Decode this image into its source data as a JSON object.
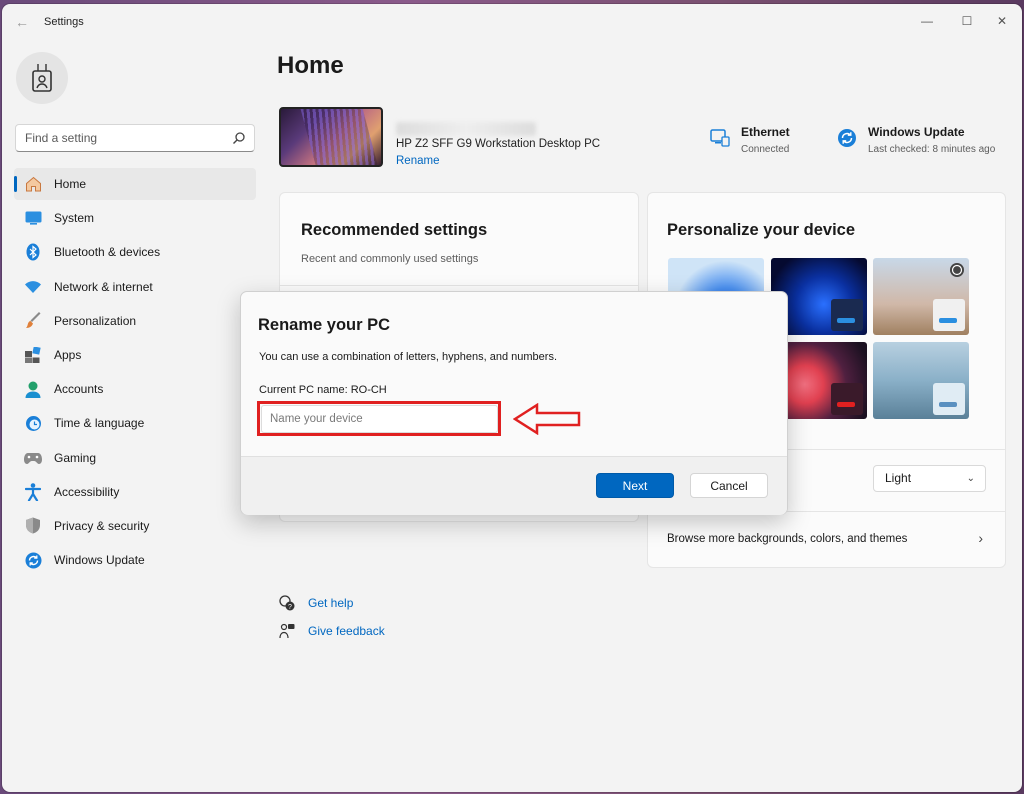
{
  "window": {
    "title": "Settings"
  },
  "sidebar": {
    "search": {
      "placeholder": "Find a setting"
    },
    "items": [
      {
        "label": "Home",
        "icon": "home-icon",
        "selected": true
      },
      {
        "label": "System",
        "icon": "system-icon"
      },
      {
        "label": "Bluetooth & devices",
        "icon": "bluetooth-icon"
      },
      {
        "label": "Network & internet",
        "icon": "wifi-icon"
      },
      {
        "label": "Personalization",
        "icon": "brush-icon"
      },
      {
        "label": "Apps",
        "icon": "apps-icon"
      },
      {
        "label": "Accounts",
        "icon": "account-icon"
      },
      {
        "label": "Time & language",
        "icon": "clock-globe-icon"
      },
      {
        "label": "Gaming",
        "icon": "gamepad-icon"
      },
      {
        "label": "Accessibility",
        "icon": "accessibility-icon"
      },
      {
        "label": "Privacy & security",
        "icon": "shield-icon"
      },
      {
        "label": "Windows Update",
        "icon": "update-icon"
      }
    ]
  },
  "main": {
    "title": "Home",
    "device": {
      "model": "HP Z2 SFF G9 Workstation Desktop PC",
      "rename_label": "Rename"
    },
    "status": {
      "ethernet": {
        "title": "Ethernet",
        "sub": "Connected"
      },
      "update": {
        "title": "Windows Update",
        "sub": "Last checked: 8 minutes ago"
      }
    },
    "recommended": {
      "title": "Recommended settings",
      "subtitle": "Recent and commonly used settings"
    },
    "personalize": {
      "title": "Personalize your device",
      "mode_value": "Light",
      "browse_label": "Browse more backgrounds, colors, and themes"
    },
    "help": {
      "get_help": "Get help",
      "give_feedback": "Give feedback"
    }
  },
  "dialog": {
    "title": "Rename your PC",
    "description": "You can use a combination of letters, hyphens, and numbers.",
    "current_name": "Current PC name: RO-CH",
    "input_placeholder": "Name your device",
    "next_label": "Next",
    "cancel_label": "Cancel"
  },
  "colors": {
    "accent": "#0067c0",
    "annotation": "#e02020"
  }
}
